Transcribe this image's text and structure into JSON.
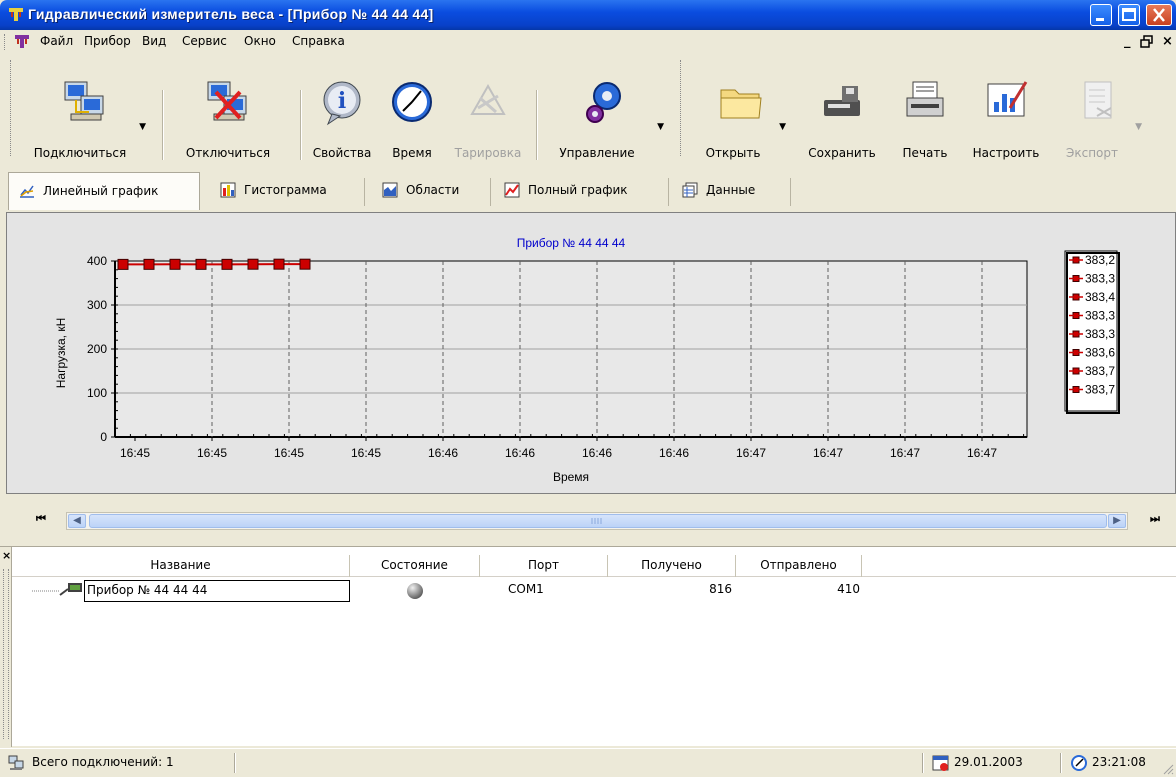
{
  "window": {
    "title": "Гидравлический измеритель веса - [Прибор № 44 44 44]"
  },
  "menu": {
    "items": [
      "Файл",
      "Прибор",
      "Вид",
      "Сервис",
      "Окно",
      "Справка"
    ],
    "mdi_minimize": "_",
    "mdi_restore": "̸",
    "mdi_close": "×"
  },
  "toolbar": {
    "connect": "Подключиться",
    "disconnect": "Отключиться",
    "properties": "Свойства",
    "time": "Время",
    "tare": "Тарировка",
    "control": "Управление",
    "open": "Открыть",
    "save": "Сохранить",
    "print": "Печать",
    "configure": "Настроить",
    "export": "Экспорт"
  },
  "tabs": {
    "line_chart": "Линейный график",
    "histogram": "Гистограмма",
    "areas": "Области",
    "full_chart": "Полный график",
    "data": "Данные"
  },
  "chart_data": {
    "type": "line",
    "title": "Прибор № 44 44 44",
    "xlabel": "Время",
    "ylabel": "Нагрузка, кН",
    "ylim": [
      0,
      400
    ],
    "y_ticks": [
      "0",
      "100",
      "200",
      "300",
      "400"
    ],
    "x_ticks": [
      "16:45",
      "16:45",
      "16:45",
      "16:45",
      "16:46",
      "16:46",
      "16:46",
      "16:46",
      "16:47",
      "16:47",
      "16:47",
      "16:47"
    ],
    "x": [
      1,
      2,
      3,
      4,
      5,
      6,
      7,
      8
    ],
    "values": [
      383.2,
      383.3,
      383.4,
      383.3,
      383.3,
      383.6,
      383.7,
      383.7
    ],
    "legend": [
      "383,2",
      "383,3",
      "383,4",
      "383,3",
      "383,3",
      "383,6",
      "383,7",
      "383,7"
    ],
    "legend_position": "right",
    "grid": true,
    "series_color": "#cc0000",
    "title_color": "#0000cc"
  },
  "table": {
    "headers": [
      "Название",
      "Состояние",
      "Порт",
      "Получено",
      "Отправлено"
    ],
    "rows": [
      {
        "name": "Прибор № 44 44 44",
        "state": "grey-circle",
        "port": "COM1",
        "received": "816",
        "sent": "410"
      }
    ]
  },
  "status": {
    "connections": "Всего подключений: 1",
    "date": "29.01.2003",
    "time": "23:21:08"
  }
}
